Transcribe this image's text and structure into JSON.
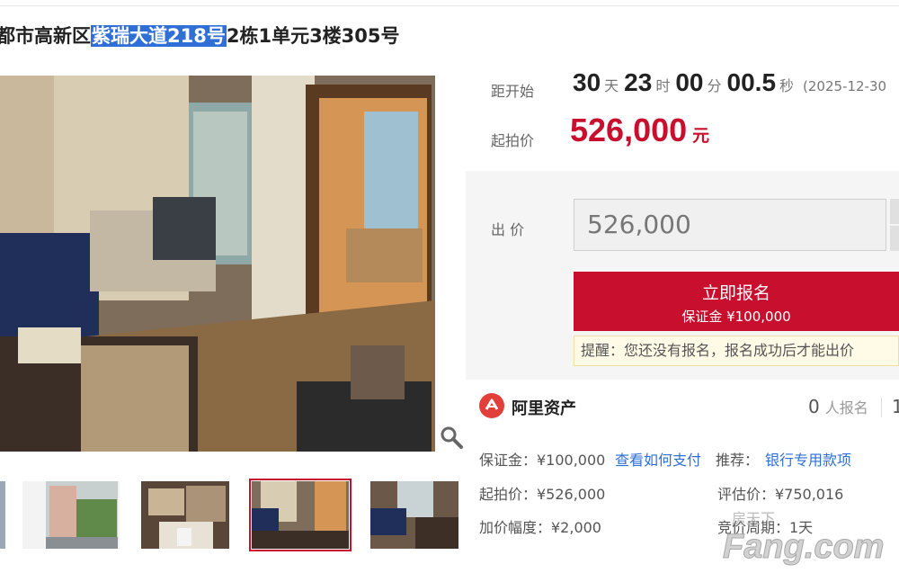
{
  "title": {
    "prefix": "都市高新区",
    "highlight": "紫瑞大道218号",
    "suffix": "2栋1单元3楼305号"
  },
  "countdown": {
    "label": "距开始",
    "days": "30",
    "days_unit": "天",
    "hours": "23",
    "hours_unit": "时",
    "minutes": "00",
    "minutes_unit": "分",
    "seconds": "00.5",
    "seconds_unit": "秒",
    "date": "(2025-12-30"
  },
  "start_price": {
    "label": "起拍价",
    "value": "526,000",
    "unit": "元"
  },
  "bid": {
    "label": "出 价",
    "input_value": "526,000",
    "signup_label": "立即报名",
    "deposit_label": "保证金 ¥100,000",
    "notice": "提醒：您还没有报名，报名成功后才能出价"
  },
  "platform": {
    "name": "阿里资产",
    "signup_count": "0",
    "signup_suffix": "人报名",
    "second_count": "1"
  },
  "details": {
    "deposit": "保证金：¥100,000",
    "how_to_pay": "查看如何支付",
    "recommend_label": "推荐：",
    "recommend_link": "银行专用款项",
    "start_price": "起拍价：¥526,000",
    "appraisal": "评估价：¥750,016",
    "increment": "加价幅度：¥2,000",
    "period": "竞价周期：1天"
  },
  "watermark": {
    "text": "Fang.com",
    "prefix": "房天下"
  },
  "colors": {
    "accent": "#c8102e",
    "link": "#2f6fd6",
    "highlight": "#2f6fd6"
  },
  "icons": [
    "zoom-icon",
    "ali-asset-logo"
  ]
}
